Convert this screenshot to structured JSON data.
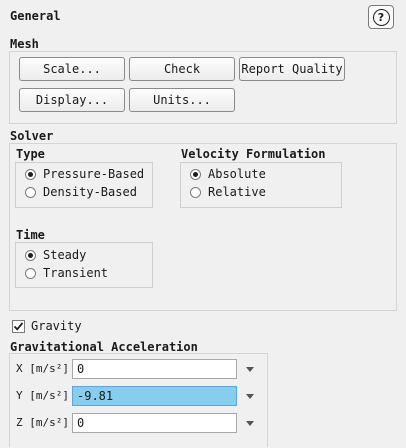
{
  "panel": {
    "title": "General"
  },
  "mesh": {
    "label": "Mesh",
    "buttons": {
      "scale": "Scale...",
      "check": "Check",
      "report_quality": "Report Quality",
      "display": "Display...",
      "units": "Units..."
    }
  },
  "solver": {
    "label": "Solver",
    "type": {
      "label": "Type",
      "options": [
        {
          "label": "Pressure-Based",
          "selected": true
        },
        {
          "label": "Density-Based",
          "selected": false
        }
      ]
    },
    "velocity_formulation": {
      "label": "Velocity Formulation",
      "options": [
        {
          "label": "Absolute",
          "selected": true
        },
        {
          "label": "Relative",
          "selected": false
        }
      ]
    },
    "time": {
      "label": "Time",
      "options": [
        {
          "label": "Steady",
          "selected": true
        },
        {
          "label": "Transient",
          "selected": false
        }
      ]
    }
  },
  "gravity": {
    "label": "Gravity",
    "checked": true
  },
  "grav_accel": {
    "label": "Gravitational Acceleration",
    "fields": [
      {
        "label": "X [m/s²]",
        "value": "0"
      },
      {
        "label": "Y [m/s²]",
        "value": "-9.81"
      },
      {
        "label": "Z [m/s²]",
        "value": "0"
      }
    ]
  },
  "icons": {
    "help": "help-icon",
    "dropdown": "dropdown-arrow-icon",
    "check": "checkmark-icon"
  }
}
